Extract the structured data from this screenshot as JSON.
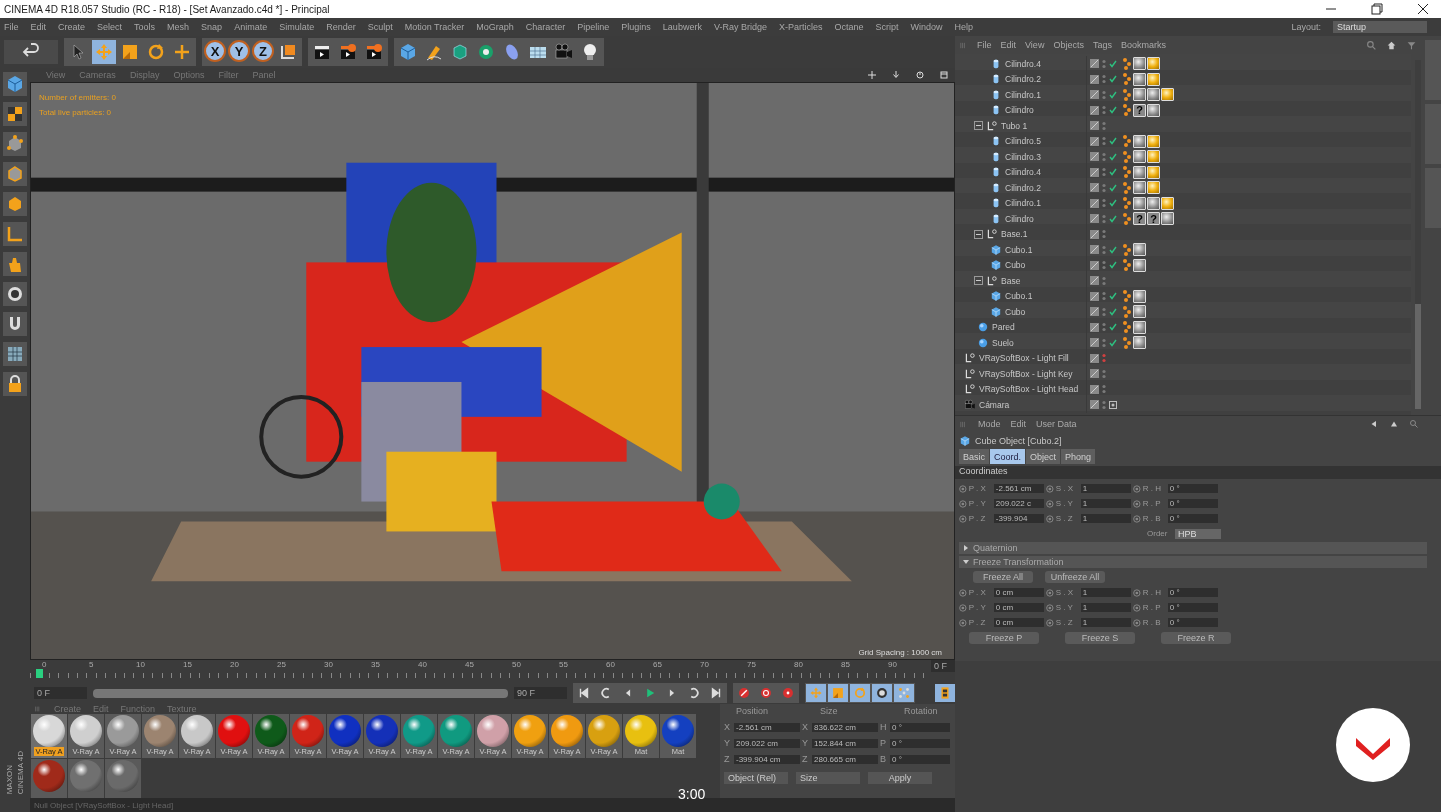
{
  "window": {
    "title": "CINEMA 4D R18.057 Studio (RC - R18) - [Set Avanzado.c4d *] - Principal"
  },
  "menu_bar": [
    "File",
    "Edit",
    "Create",
    "Select",
    "Tools",
    "Mesh",
    "Snap",
    "Animate",
    "Simulate",
    "Render",
    "Sculpt",
    "Motion Tracker",
    "MoGraph",
    "Character",
    "Pipeline",
    "Plugins",
    "Laubwerk",
    "V-Ray Bridge",
    "X-Particles",
    "Octane",
    "Script",
    "Window",
    "Help"
  ],
  "layout": {
    "label": "Layout:",
    "value": "Startup"
  },
  "axis_buttons": [
    {
      "label": "X",
      "on": true
    },
    {
      "label": "Y",
      "on": true
    },
    {
      "label": "Z",
      "on": true
    }
  ],
  "viewport": {
    "menu": [
      "View",
      "Cameras",
      "Display",
      "Options",
      "Filter",
      "Panel"
    ],
    "hud": [
      "Number of emitters: 0",
      "Total live particles: 0"
    ],
    "grid_spacing": "Grid Spacing : 1000 cm"
  },
  "object_manager": {
    "menu": [
      "File",
      "Edit",
      "View",
      "Objects",
      "Tags",
      "Bookmarks"
    ],
    "tree": [
      {
        "children": [
          {
            "children": [
              {
                "name": "Cilindro.4",
                "kind": "cylinder",
                "checked": true,
                "render_off": false,
                "tags": [
                  {
                    "kind": "phong"
                  },
                  {
                    "kind": "grey"
                  },
                  {
                    "kind": "gold"
                  }
                ]
              },
              {
                "name": "Cilindro.2",
                "kind": "cylinder",
                "checked": true,
                "render_off": false,
                "tags": [
                  {
                    "kind": "phong"
                  },
                  {
                    "kind": "grey"
                  },
                  {
                    "kind": "gold"
                  }
                ]
              },
              {
                "name": "Cilindro.1",
                "kind": "cylinder",
                "checked": true,
                "render_off": false,
                "tags": [
                  {
                    "kind": "phong"
                  },
                  {
                    "kind": "grey"
                  },
                  {
                    "kind": "grey"
                  },
                  {
                    "kind": "gold"
                  }
                ]
              },
              {
                "name": "Cilindro",
                "kind": "cylinder",
                "checked": true,
                "render_off": false,
                "tags": [
                  {
                    "kind": "phong"
                  },
                  {
                    "kind": "missing",
                    "label": "?"
                  },
                  {
                    "kind": "grey"
                  }
                ]
              }
            ]
          },
          {
            "name": "Tubo 1",
            "kind": "null",
            "expanded": true,
            "checked": false,
            "render_off": false,
            "children": [
              {
                "name": "Cilindro.5",
                "kind": "cylinder",
                "checked": true,
                "render_off": false,
                "tags": [
                  {
                    "kind": "phong"
                  },
                  {
                    "kind": "grey"
                  },
                  {
                    "kind": "gold"
                  }
                ]
              },
              {
                "name": "Cilindro.3",
                "kind": "cylinder",
                "checked": true,
                "render_off": false,
                "tags": [
                  {
                    "kind": "phong"
                  },
                  {
                    "kind": "grey"
                  },
                  {
                    "kind": "gold"
                  }
                ]
              },
              {
                "name": "Cilindro.4",
                "kind": "cylinder",
                "checked": true,
                "render_off": false,
                "tags": [
                  {
                    "kind": "phong"
                  },
                  {
                    "kind": "grey"
                  },
                  {
                    "kind": "gold"
                  }
                ]
              },
              {
                "name": "Cilindro.2",
                "kind": "cylinder",
                "checked": true,
                "render_off": false,
                "tags": [
                  {
                    "kind": "phong"
                  },
                  {
                    "kind": "grey"
                  },
                  {
                    "kind": "gold"
                  }
                ]
              },
              {
                "name": "Cilindro.1",
                "kind": "cylinder",
                "checked": true,
                "render_off": false,
                "tags": [
                  {
                    "kind": "phong"
                  },
                  {
                    "kind": "grey"
                  },
                  {
                    "kind": "grey"
                  },
                  {
                    "kind": "gold"
                  }
                ]
              },
              {
                "name": "Cilindro",
                "kind": "cylinder",
                "checked": true,
                "render_off": false,
                "tags": [
                  {
                    "kind": "phong"
                  },
                  {
                    "kind": "missing",
                    "label": "?"
                  },
                  {
                    "kind": "missing",
                    "label": "?"
                  },
                  {
                    "kind": "grey"
                  }
                ]
              }
            ]
          },
          {
            "name": "Base.1",
            "kind": "null",
            "expanded": true,
            "checked": false,
            "render_off": false,
            "children": [
              {
                "name": "Cubo.1",
                "kind": "cube",
                "checked": true,
                "render_off": false,
                "tags": [
                  {
                    "kind": "phong"
                  },
                  {
                    "kind": "grey"
                  }
                ]
              },
              {
                "name": "Cubo",
                "kind": "cube",
                "checked": true,
                "render_off": false,
                "tags": [
                  {
                    "kind": "phong"
                  },
                  {
                    "kind": "grey"
                  }
                ]
              }
            ]
          },
          {
            "name": "Base",
            "kind": "null",
            "expanded": true,
            "checked": false,
            "render_off": false,
            "children": [
              {
                "name": "Cubo.1",
                "kind": "cube",
                "checked": true,
                "render_off": false,
                "tags": [
                  {
                    "kind": "phong"
                  },
                  {
                    "kind": "grey"
                  }
                ]
              },
              {
                "name": "Cubo",
                "kind": "cube",
                "checked": true,
                "render_off": false,
                "tags": [
                  {
                    "kind": "phong"
                  },
                  {
                    "kind": "grey"
                  }
                ]
              }
            ]
          },
          {
            "name": "Pared",
            "kind": "sphere",
            "checked": true,
            "render_off": false,
            "tags": [
              {
                "kind": "phong"
              },
              {
                "kind": "grey"
              }
            ]
          },
          {
            "name": "Suelo",
            "kind": "sphere",
            "checked": true,
            "render_off": false,
            "tags": [
              {
                "kind": "phong"
              },
              {
                "kind": "grey"
              }
            ]
          }
        ]
      },
      {
        "name": "VRaySoftBox - Light Fill",
        "kind": "null",
        "checked": false,
        "render_off": true
      },
      {
        "name": "VRaySoftBox - Light Key",
        "kind": "null",
        "checked": false,
        "render_off": false
      },
      {
        "name": "VRaySoftBox - Light  Head",
        "kind": "null",
        "checked": false,
        "render_off": false
      },
      {
        "name": "Cámara",
        "kind": "camera",
        "checked": false,
        "render_off": false
      }
    ]
  },
  "attributes": {
    "menu": [
      "Mode",
      "Edit",
      "User Data"
    ],
    "object": "Cube Object [Cubo.2]",
    "tabs": [
      {
        "label": "Basic",
        "selected": false
      },
      {
        "label": "Coord.",
        "selected": true
      },
      {
        "label": "Object",
        "selected": false
      },
      {
        "label": "Phong",
        "selected": false
      }
    ],
    "section": "Coordinates",
    "rows": [
      [
        {
          "label": "P . X",
          "value": "-2.561 cm"
        },
        {
          "label": "S . X",
          "value": "1"
        },
        {
          "label": "R . H",
          "value": "0 °"
        }
      ],
      [
        {
          "label": "P . Y",
          "value": "209.022 c"
        },
        {
          "label": "S . Y",
          "value": "1"
        },
        {
          "label": "R . P",
          "value": "0 °"
        }
      ],
      [
        {
          "label": "P . Z",
          "value": "-399.904"
        },
        {
          "label": "S . Z",
          "value": "1"
        },
        {
          "label": "R . B",
          "value": "0 °"
        }
      ]
    ],
    "order": {
      "label": "Order",
      "value": "HPB"
    },
    "groups": [
      {
        "label": "Quaternion",
        "expanded": false
      },
      {
        "label": "Freeze Transformation",
        "expanded": true
      }
    ],
    "freeze_buttons": [
      "Freeze All",
      "Unfreeze All"
    ],
    "freeze_rows": [
      [
        {
          "label": "P . X",
          "value": "0 cm"
        },
        {
          "label": "S . X",
          "value": "1"
        },
        {
          "label": "R . H",
          "value": "0 °"
        }
      ],
      [
        {
          "label": "P . Y",
          "value": "0 cm"
        },
        {
          "label": "S . Y",
          "value": "1"
        },
        {
          "label": "R . P",
          "value": "0 °"
        }
      ],
      [
        {
          "label": "P . Z",
          "value": "0 cm"
        },
        {
          "label": "S . Z",
          "value": "1"
        },
        {
          "label": "R . B",
          "value": "0 °"
        }
      ]
    ],
    "apply_buttons": [
      "Freeze P",
      "Freeze S",
      "Freeze R"
    ]
  },
  "timeline": {
    "frames": [
      "0",
      "5",
      "10",
      "15",
      "20",
      "25",
      "30",
      "35",
      "40",
      "45",
      "50",
      "55",
      "60",
      "65",
      "70",
      "75",
      "80",
      "85",
      "90"
    ],
    "current": "0 F",
    "playhead": {
      "level": 0
    },
    "start": "0 F",
    "end": "90 F"
  },
  "materials": {
    "menu": [
      "Create",
      "Edit",
      "Function",
      "Texture"
    ],
    "items": [
      {
        "name": "V-Ray A",
        "color": "#d8d8d8",
        "selected": true
      },
      {
        "name": "V-Ray A",
        "color": "#cfcfcf",
        "selected": false
      },
      {
        "name": "V-Ray A",
        "color": "#9a9a9a",
        "selected": false
      },
      {
        "name": "V-Ray A",
        "color": "#9c8470",
        "selected": false
      },
      {
        "name": "V-Ray A",
        "color": "#c8c8c8",
        "selected": false
      },
      {
        "name": "V-Ray A",
        "color": "#e01010",
        "selected": false
      },
      {
        "name": "V-Ray A",
        "color": "#0f5a1a",
        "selected": false
      },
      {
        "name": "V-Ray A",
        "color": "#d02418",
        "selected": false
      },
      {
        "name": "V-Ray A",
        "color": "#1030c0",
        "selected": false
      },
      {
        "name": "V-Ray A",
        "color": "#1430b8",
        "selected": false
      },
      {
        "name": "V-Ray A",
        "color": "#109a88",
        "selected": false
      },
      {
        "name": "V-Ray A",
        "color": "#109a80",
        "selected": false
      },
      {
        "name": "V-Ray A",
        "color": "#d0a0a8",
        "selected": false
      },
      {
        "name": "V-Ray A",
        "color": "#f0a010",
        "selected": false
      },
      {
        "name": "V-Ray A",
        "color": "#f09a10",
        "selected": false
      },
      {
        "name": "V-Ray A",
        "color": "#d8a010",
        "selected": false
      },
      {
        "name": "Mat",
        "color": "#e8c010",
        "selected": false
      },
      {
        "name": "Mat",
        "color": "#1440c0",
        "selected": false
      },
      {
        "color": "#a02a1a",
        "selected": false
      },
      {
        "color": "#707070",
        "selected": false
      },
      {
        "color": "#6a6a6a",
        "selected": false
      }
    ]
  },
  "coordinates": {
    "headers": [
      "Position",
      "Size",
      "Rotation"
    ],
    "rows": [
      [
        {
          "label": "X",
          "value": "-2.561 cm"
        },
        {
          "label": "X",
          "value": "836.622 cm"
        },
        {
          "label": "H",
          "value": "0 °"
        }
      ],
      [
        {
          "label": "Y",
          "value": "209.022 cm"
        },
        {
          "label": "Y",
          "value": "152.844 cm"
        },
        {
          "label": "P",
          "value": "0 °"
        }
      ],
      [
        {
          "label": "Z",
          "value": "-399.904 cm"
        },
        {
          "label": "Z",
          "value": "280.665 cm"
        },
        {
          "label": "B",
          "value": "0 °"
        }
      ]
    ],
    "mode": "Object (Rel)",
    "size_mode": "Size",
    "apply": "Apply"
  },
  "status_bar": "Null Object [VRaySoftBox - Light Head]",
  "logo": [
    "MAXON",
    "CINEMA 4D"
  ],
  "video": {
    "time": "3:00"
  }
}
